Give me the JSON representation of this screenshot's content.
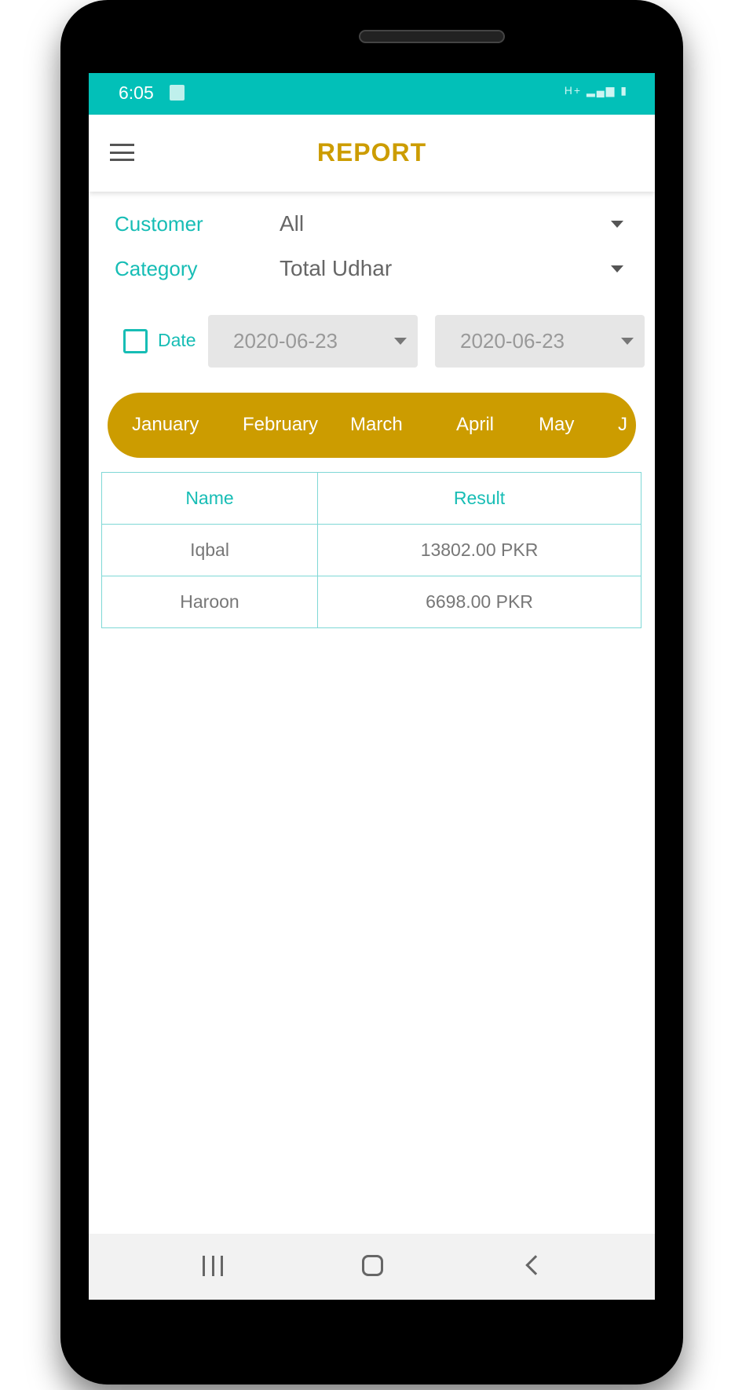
{
  "status": {
    "time": "6:05",
    "network": "H+",
    "icons": [
      "wifi-icon",
      "signal-icon",
      "battery-charging-icon"
    ]
  },
  "appbar": {
    "title": "REPORT"
  },
  "filters": {
    "customer": {
      "label": "Customer",
      "value": "All"
    },
    "category": {
      "label": "Category",
      "value": "Total Udhar"
    },
    "date": {
      "label": "Date",
      "checked": false,
      "from": "2020-06-23",
      "to": "2020-06-23"
    }
  },
  "months": [
    "January",
    "February",
    "March",
    "April",
    "May",
    "J"
  ],
  "table": {
    "headers": [
      "Name",
      "Result"
    ],
    "rows": [
      [
        "Iqbal",
        "13802.00 PKR"
      ],
      [
        "Haroon",
        "6698.00 PKR"
      ]
    ]
  },
  "colors": {
    "primary": "#02c0b8",
    "accent": "#cc9c00"
  }
}
